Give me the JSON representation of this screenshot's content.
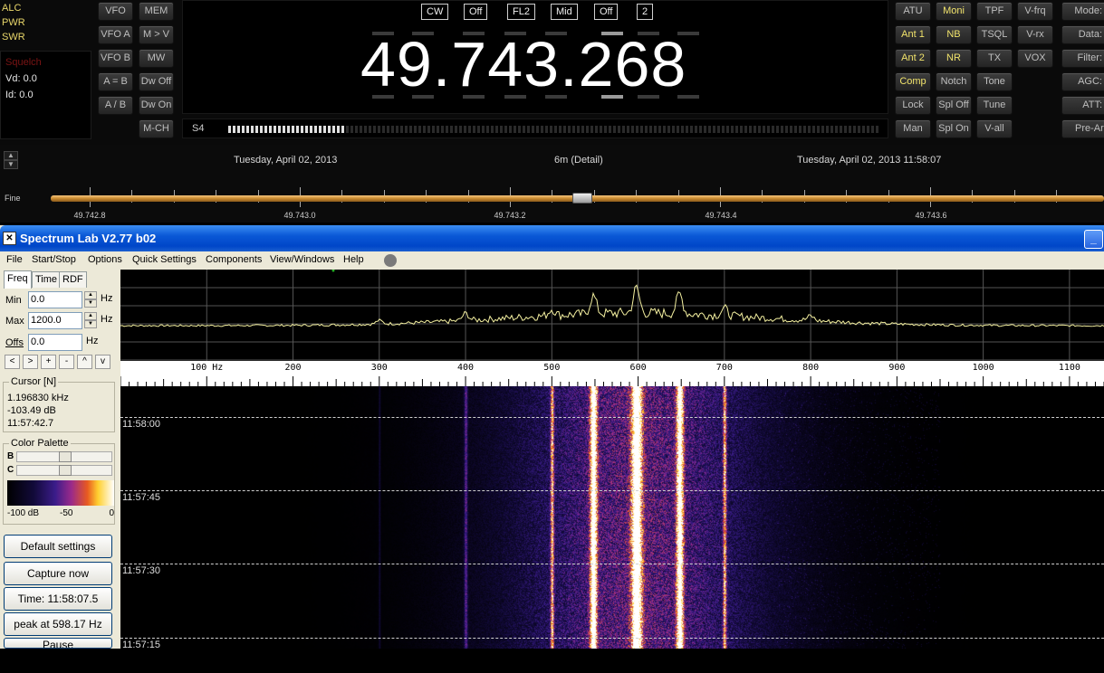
{
  "radio": {
    "meters": [
      "ALC",
      "PWR",
      "SWR"
    ],
    "status": {
      "squelch": "Squelch",
      "vd": "Vd: 0.0",
      "id": "Id: 0.0"
    },
    "left_buttons": [
      "VFO",
      "MEM",
      "VFO A",
      "M > V",
      "VFO B",
      "MW",
      "A = B",
      "Dw Off",
      "A / B",
      "Dw On",
      "M-CH"
    ],
    "mode_tags": [
      "CW",
      "Off",
      "FL2",
      "Mid",
      "Off",
      "2"
    ],
    "frequency": "49.743.268",
    "s_meter": {
      "label": "S4",
      "level": 0.18
    },
    "right_buttons": [
      "ATU",
      "Moni",
      "TPF",
      "V-frq",
      "Ant 1",
      "NB",
      "TSQL",
      "V-rx",
      "Ant 2",
      "NR",
      "TX",
      "VOX",
      "Comp",
      "Notch",
      "Tone",
      "Lock",
      "Spl Off",
      "Tune",
      "Man",
      "Spl On",
      "V-all"
    ],
    "far_right": [
      "Mode:",
      "Data:",
      "Filter:",
      "AGC:",
      "ATT:",
      "Pre-Ar"
    ]
  },
  "band": {
    "date_left": "Tuesday, April 02, 2013",
    "band_name": "6m (Detail)",
    "datetime_right": "Tuesday, April 02, 2013 11:58:07",
    "fine_label": "Fine",
    "labels": [
      "49.742.8",
      "49.743.0",
      "49.743.2",
      "49.743.4",
      "49.743.6"
    ]
  },
  "spectrum_lab": {
    "title": "Spectrum Lab V2.77 b02",
    "menu": [
      "File",
      "Start/Stop",
      "Options",
      "Quick Settings",
      "Components",
      "View/Windows",
      "Help"
    ],
    "tabs": [
      "Freq",
      "Time",
      "RDF"
    ],
    "min_label": "Min",
    "min_value": "0.0",
    "max_label": "Max",
    "max_value": "1200.0",
    "offs_label": "Offs",
    "offs_value": "0.0",
    "unit": "Hz",
    "small_buttons": [
      "<",
      ">",
      "+",
      "-",
      "^",
      "v"
    ],
    "cursor_title": "Cursor [N]",
    "cursor": [
      "1.196830 kHz",
      "-103.49 dB",
      "11:57:42.7"
    ],
    "palette_title": "Color Palette",
    "palette_b": "B",
    "palette_c": "C",
    "palette_scale": [
      "-100 dB",
      "-50",
      "0"
    ],
    "buttons": [
      "Default settings",
      "Capture now",
      "Time:  11:58:07.5",
      "peak at 598.17 Hz",
      "Pause"
    ],
    "freq_axis": [
      "100 Hz",
      "200",
      "300",
      "400",
      "500",
      "600",
      "700",
      "800",
      "900",
      "1000",
      "1100"
    ],
    "time_marks": [
      "11:58:00",
      "11:57:45",
      "11:57:30",
      "11:57:15"
    ]
  }
}
